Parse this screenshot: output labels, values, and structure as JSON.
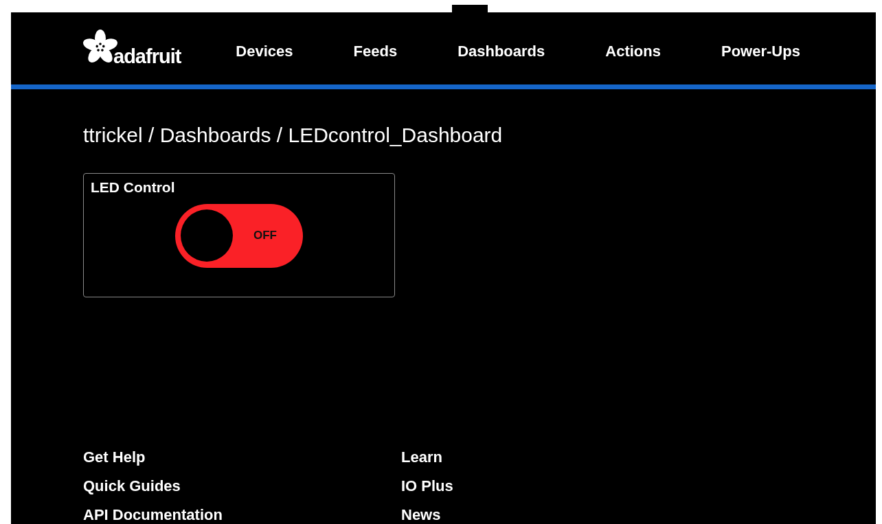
{
  "header": {
    "logo_text": "adafruit",
    "nav": [
      {
        "label": "Devices"
      },
      {
        "label": "Feeds"
      },
      {
        "label": "Dashboards"
      },
      {
        "label": "Actions"
      },
      {
        "label": "Power-Ups"
      }
    ]
  },
  "breadcrumb": "ttrickel / Dashboards / LEDcontrol_Dashboard",
  "blocks": [
    {
      "kind": "toggle",
      "title": "LED Control",
      "on": false,
      "state_label": "OFF"
    }
  ],
  "footer": {
    "columns": [
      [
        "Get Help",
        "Quick Guides",
        "API Documentation"
      ],
      [
        "Learn",
        "IO Plus",
        "News"
      ]
    ]
  }
}
